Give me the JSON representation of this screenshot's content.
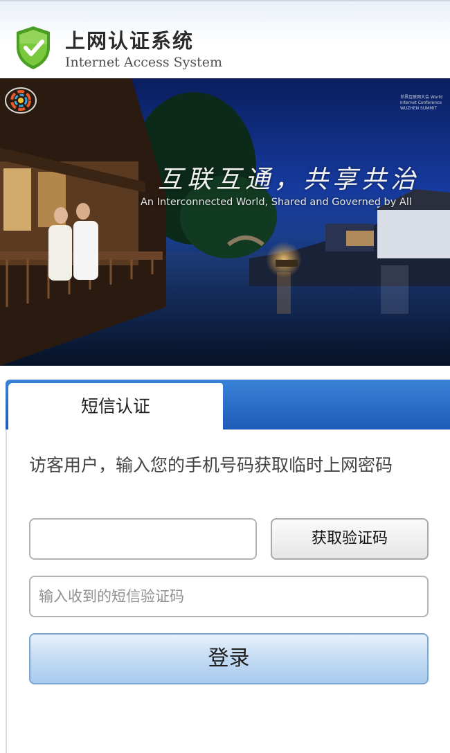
{
  "header": {
    "title_cn": "上网认证系统",
    "title_en": "Internet Access System",
    "logo_icon": "shield-check-icon",
    "logo_color": "#5cb82e"
  },
  "banner": {
    "slogan_cn": "互联互通，共享共治",
    "slogan_en": "An Interconnected World, Shared and Governed by All",
    "conference_logo": "world-internet-conference-logo",
    "conference_text": "世界互联网大会 World Internet Conference WUZHEN SUMMIT"
  },
  "tabs": [
    {
      "label": "短信认证",
      "active": true
    }
  ],
  "form": {
    "description": "访客用户，输入您的手机号码获取临时上网密码",
    "phone_value": "",
    "get_code_label": "获取验证码",
    "sms_placeholder": "输入收到的短信验证码",
    "login_label": "登录"
  },
  "colors": {
    "tab_bar": "#1e5cb8",
    "login_button": "#a9cbee",
    "brand_green": "#5cb82e"
  }
}
